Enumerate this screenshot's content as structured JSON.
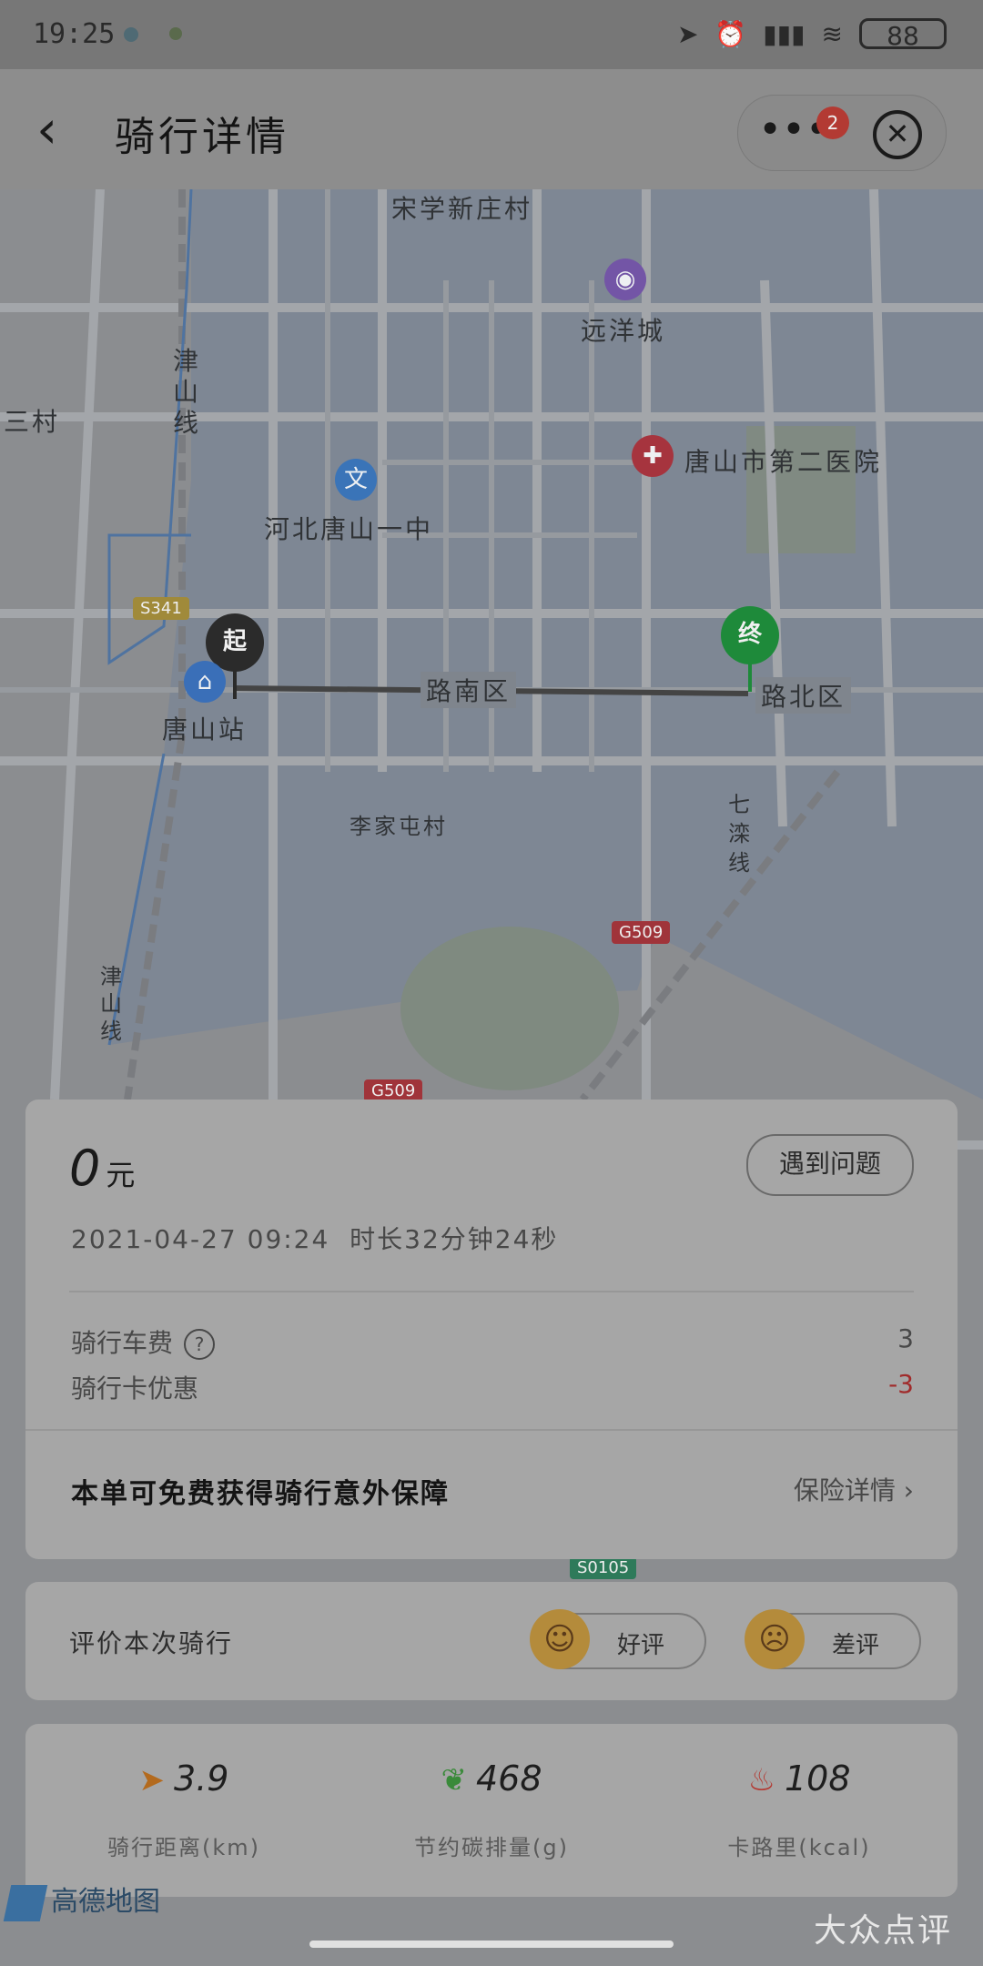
{
  "status_bar": {
    "time": "19:25",
    "battery": "88"
  },
  "nav": {
    "title": "骑行详情",
    "badge_count": "2"
  },
  "map": {
    "labels": {
      "top_village": "宋学新庄村",
      "yuanyang": "远洋城",
      "hospital": "唐山市第二医院",
      "school": "河北唐山一中",
      "left_village": "三村",
      "jinshan_line": "津山线",
      "lunan": "路南区",
      "lubei": "路北区",
      "station": "唐山站",
      "lijia": "李家屯村",
      "qixian": "七滦线",
      "jinshan_line2": "津山线"
    },
    "roads": {
      "s341": "S341",
      "g509a": "G509",
      "g509b": "G509",
      "s0105": "S0105"
    },
    "start_pin": "起",
    "end_pin": "终",
    "school_icon": "文"
  },
  "fare": {
    "amount": "0",
    "unit": "元",
    "problem_button": "遇到问题",
    "date_time": "2021-04-27 09:24",
    "duration": "时长32分钟24秒",
    "fee_label": "骑行车费",
    "fee_value": "3",
    "discount_label": "骑行卡优惠",
    "discount_value": "-3",
    "insurance_text": "本单可免费获得骑行意外保障",
    "insurance_link": "保险详情"
  },
  "rating": {
    "label": "评价本次骑行",
    "good": "好评",
    "bad": "差评"
  },
  "stats": {
    "distance_value": "3.9",
    "distance_label": "骑行距离(km)",
    "carbon_value": "468",
    "carbon_label": "节约碳排量(g)",
    "calorie_value": "108",
    "calorie_label": "卡路里(kcal)"
  },
  "footer": {
    "amap": "高德地图",
    "watermark": "大众点评"
  },
  "colors": {
    "route": "#444444",
    "start_pin": "#2b2b2b",
    "end_pin": "#1e8a3a",
    "discount": "#a02b2b"
  }
}
